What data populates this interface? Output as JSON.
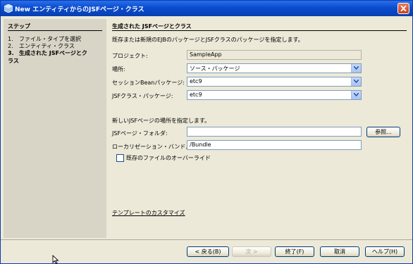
{
  "window": {
    "title": "New エンティティからのJSFページ・クラス",
    "close_icon": "close-icon"
  },
  "steps": {
    "header": "ステップ",
    "items": [
      {
        "num": "1.",
        "label": "ファイル・タイプを選択"
      },
      {
        "num": "2.",
        "label": "エンティティ・クラス"
      },
      {
        "num": "3.",
        "label": "生成された JSFページとクラス"
      }
    ]
  },
  "main": {
    "section_title": "生成された JSFページとクラス",
    "description": "既存または新規のEJBのパッケージとJSFクラスのパッケージを指定します。",
    "project_label": "プロジェクト:",
    "project_value": "SampleApp",
    "location_label": "場所:",
    "location_value": "ソース・パッケージ",
    "session_bean_label": "セッションBeanパッケージ:",
    "session_bean_value": "etc9",
    "jsf_class_label": "JSFクラス・パッケージ:",
    "jsf_class_value": "etc9",
    "jsf_location_desc": "新しいJSFページの場所を指定します。",
    "jsf_folder_label": "JSFページ・フォルダ:",
    "jsf_folder_value": "",
    "browse_label": "参照...",
    "localization_label": "ローカリゼーション・バンドル名:",
    "localization_value": "/Bundle",
    "overwrite_label": "既存のファイルのオーバーライド",
    "overwrite_checked": false,
    "customize_link": "テンプレートのカスタマイズ"
  },
  "footer": {
    "back_label": "< 戻る(B)",
    "next_label": "次 >",
    "finish_label": "終了(F)",
    "cancel_label": "取消",
    "help_label": "ヘルプ(H)"
  }
}
